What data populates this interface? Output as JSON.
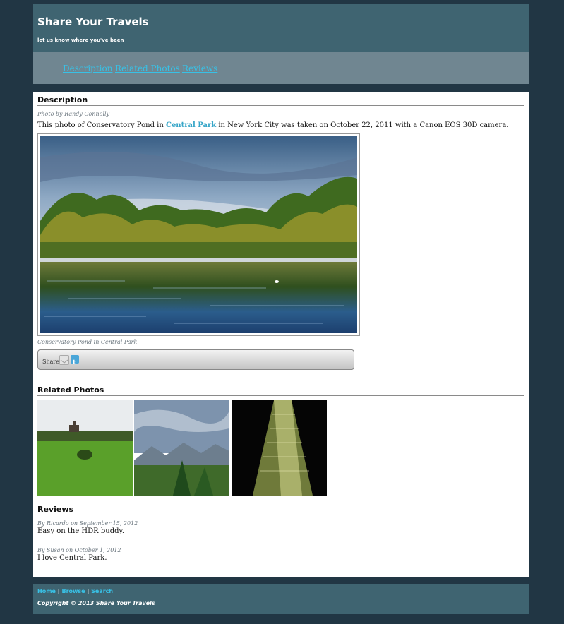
{
  "header": {
    "title": "Share Your Travels",
    "tagline": "let us know where you've been"
  },
  "nav": {
    "items": [
      {
        "label": "Description"
      },
      {
        "label": "Related Photos"
      },
      {
        "label": "Reviews"
      }
    ]
  },
  "description": {
    "heading": "Description",
    "byline": "Photo by Randy Connolly",
    "text_before": "This photo of Conservatory Pond in ",
    "link": "Central Park",
    "text_after": " in New York City was taken on October 22, 2011 with a Canon EOS 30D camera.",
    "caption": "Conservatory Pond in Central Park",
    "share_label": "Share:",
    "share_icons": [
      "email-icon",
      "twitter-icon"
    ]
  },
  "related": {
    "heading": "Related Photos",
    "photos": [
      "field-with-church-photo",
      "mountain-valley-photo",
      "skyscraper-photo"
    ]
  },
  "reviews": {
    "heading": "Reviews",
    "items": [
      {
        "by": "By Ricardo on September 15, 2012",
        "text": "Easy on the HDR buddy."
      },
      {
        "by": "By Susan on October 1, 2012",
        "text": "I love Central Park."
      }
    ]
  },
  "footer": {
    "links": [
      {
        "label": "Home"
      },
      {
        "label": "Browse"
      },
      {
        "label": "Search"
      }
    ],
    "separator": "|",
    "copyright": "Copyright © 2013 Share Your Travels"
  },
  "colors": {
    "page_bg": "#213644",
    "header_bg": "#3f6471",
    "nav_bg": "#708691",
    "link": "#38c1e6"
  }
}
